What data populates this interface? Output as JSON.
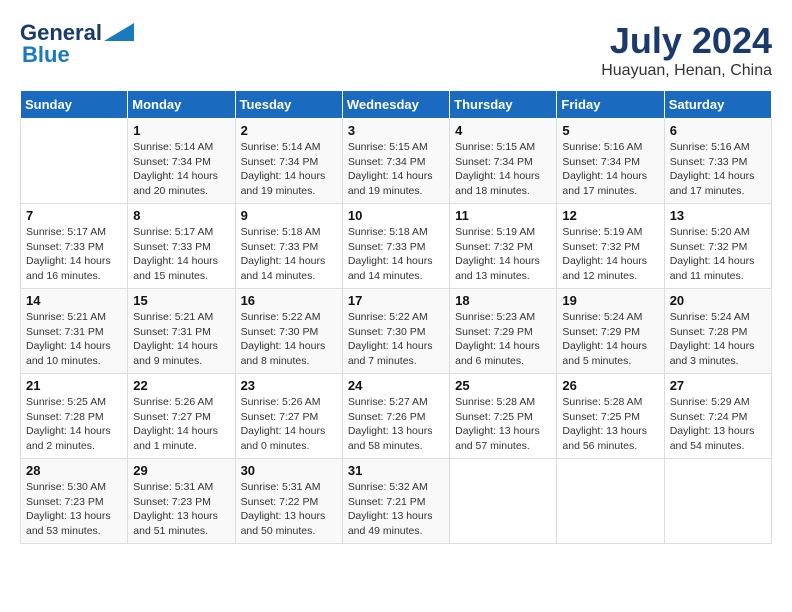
{
  "logo": {
    "general": "General",
    "blue": "Blue"
  },
  "title": {
    "month_year": "July 2024",
    "location": "Huayuan, Henan, China"
  },
  "days_of_week": [
    "Sunday",
    "Monday",
    "Tuesday",
    "Wednesday",
    "Thursday",
    "Friday",
    "Saturday"
  ],
  "weeks": [
    [
      {
        "day": "",
        "info": ""
      },
      {
        "day": "1",
        "info": "Sunrise: 5:14 AM\nSunset: 7:34 PM\nDaylight: 14 hours\nand 20 minutes."
      },
      {
        "day": "2",
        "info": "Sunrise: 5:14 AM\nSunset: 7:34 PM\nDaylight: 14 hours\nand 19 minutes."
      },
      {
        "day": "3",
        "info": "Sunrise: 5:15 AM\nSunset: 7:34 PM\nDaylight: 14 hours\nand 19 minutes."
      },
      {
        "day": "4",
        "info": "Sunrise: 5:15 AM\nSunset: 7:34 PM\nDaylight: 14 hours\nand 18 minutes."
      },
      {
        "day": "5",
        "info": "Sunrise: 5:16 AM\nSunset: 7:34 PM\nDaylight: 14 hours\nand 17 minutes."
      },
      {
        "day": "6",
        "info": "Sunrise: 5:16 AM\nSunset: 7:33 PM\nDaylight: 14 hours\nand 17 minutes."
      }
    ],
    [
      {
        "day": "7",
        "info": "Sunrise: 5:17 AM\nSunset: 7:33 PM\nDaylight: 14 hours\nand 16 minutes."
      },
      {
        "day": "8",
        "info": "Sunrise: 5:17 AM\nSunset: 7:33 PM\nDaylight: 14 hours\nand 15 minutes."
      },
      {
        "day": "9",
        "info": "Sunrise: 5:18 AM\nSunset: 7:33 PM\nDaylight: 14 hours\nand 14 minutes."
      },
      {
        "day": "10",
        "info": "Sunrise: 5:18 AM\nSunset: 7:33 PM\nDaylight: 14 hours\nand 14 minutes."
      },
      {
        "day": "11",
        "info": "Sunrise: 5:19 AM\nSunset: 7:32 PM\nDaylight: 14 hours\nand 13 minutes."
      },
      {
        "day": "12",
        "info": "Sunrise: 5:19 AM\nSunset: 7:32 PM\nDaylight: 14 hours\nand 12 minutes."
      },
      {
        "day": "13",
        "info": "Sunrise: 5:20 AM\nSunset: 7:32 PM\nDaylight: 14 hours\nand 11 minutes."
      }
    ],
    [
      {
        "day": "14",
        "info": "Sunrise: 5:21 AM\nSunset: 7:31 PM\nDaylight: 14 hours\nand 10 minutes."
      },
      {
        "day": "15",
        "info": "Sunrise: 5:21 AM\nSunset: 7:31 PM\nDaylight: 14 hours\nand 9 minutes."
      },
      {
        "day": "16",
        "info": "Sunrise: 5:22 AM\nSunset: 7:30 PM\nDaylight: 14 hours\nand 8 minutes."
      },
      {
        "day": "17",
        "info": "Sunrise: 5:22 AM\nSunset: 7:30 PM\nDaylight: 14 hours\nand 7 minutes."
      },
      {
        "day": "18",
        "info": "Sunrise: 5:23 AM\nSunset: 7:29 PM\nDaylight: 14 hours\nand 6 minutes."
      },
      {
        "day": "19",
        "info": "Sunrise: 5:24 AM\nSunset: 7:29 PM\nDaylight: 14 hours\nand 5 minutes."
      },
      {
        "day": "20",
        "info": "Sunrise: 5:24 AM\nSunset: 7:28 PM\nDaylight: 14 hours\nand 3 minutes."
      }
    ],
    [
      {
        "day": "21",
        "info": "Sunrise: 5:25 AM\nSunset: 7:28 PM\nDaylight: 14 hours\nand 2 minutes."
      },
      {
        "day": "22",
        "info": "Sunrise: 5:26 AM\nSunset: 7:27 PM\nDaylight: 14 hours\nand 1 minute."
      },
      {
        "day": "23",
        "info": "Sunrise: 5:26 AM\nSunset: 7:27 PM\nDaylight: 14 hours\nand 0 minutes."
      },
      {
        "day": "24",
        "info": "Sunrise: 5:27 AM\nSunset: 7:26 PM\nDaylight: 13 hours\nand 58 minutes."
      },
      {
        "day": "25",
        "info": "Sunrise: 5:28 AM\nSunset: 7:25 PM\nDaylight: 13 hours\nand 57 minutes."
      },
      {
        "day": "26",
        "info": "Sunrise: 5:28 AM\nSunset: 7:25 PM\nDaylight: 13 hours\nand 56 minutes."
      },
      {
        "day": "27",
        "info": "Sunrise: 5:29 AM\nSunset: 7:24 PM\nDaylight: 13 hours\nand 54 minutes."
      }
    ],
    [
      {
        "day": "28",
        "info": "Sunrise: 5:30 AM\nSunset: 7:23 PM\nDaylight: 13 hours\nand 53 minutes."
      },
      {
        "day": "29",
        "info": "Sunrise: 5:31 AM\nSunset: 7:23 PM\nDaylight: 13 hours\nand 51 minutes."
      },
      {
        "day": "30",
        "info": "Sunrise: 5:31 AM\nSunset: 7:22 PM\nDaylight: 13 hours\nand 50 minutes."
      },
      {
        "day": "31",
        "info": "Sunrise: 5:32 AM\nSunset: 7:21 PM\nDaylight: 13 hours\nand 49 minutes."
      },
      {
        "day": "",
        "info": ""
      },
      {
        "day": "",
        "info": ""
      },
      {
        "day": "",
        "info": ""
      }
    ]
  ]
}
